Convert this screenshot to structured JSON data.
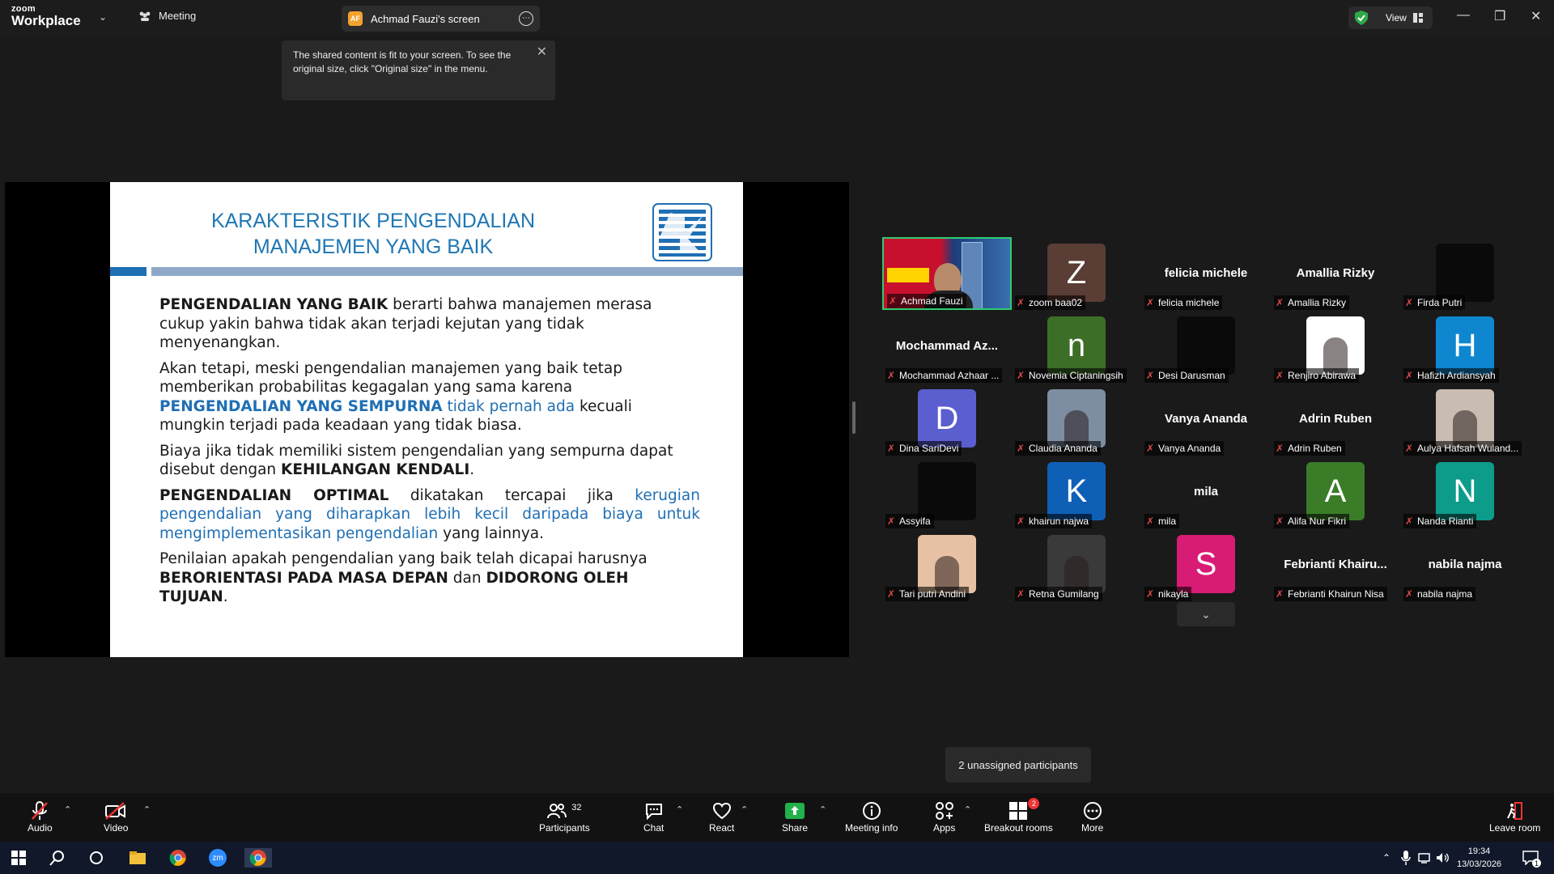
{
  "topbar": {
    "logo_small": "zoom",
    "logo_big": "Workplace",
    "meeting_label": "Meeting",
    "share_tab_initials": "AF",
    "share_tab_label": "Achmad Fauzi's screen",
    "view_label": "View"
  },
  "tooltip": {
    "text": "The shared content is fit to your screen. To see the original size, click \"Original size\" in the menu."
  },
  "slide": {
    "title": "KARAKTERISTIK PENGENDALIAN MANAJEMEN YANG BAIK",
    "p1_bold": "PENGENDALIAN YANG BAIK",
    "p1_rest": " berarti bahwa manajemen merasa cukup yakin bahwa tidak akan terjadi kejutan yang tidak menyenangkan.",
    "p2_a": "Akan tetapi, meski pengendalian manajemen yang baik tetap memberikan probabilitas kegagalan yang sama karena ",
    "p2_blue_bold": "PENGENDALIAN YANG SEMPURNA",
    "p2_blue": " tidak pernah ada",
    "p2_rest": " kecuali mungkin terjadi pada keadaan yang tidak biasa.",
    "p3_a": "Biaya jika tidak memiliki sistem pengendalian yang sempurna dapat disebut dengan ",
    "p3_bold": "KEHILANGAN KENDALI",
    "p3_end": ".",
    "p4_bold": "PENGENDALIAN OPTIMAL",
    "p4_a": " dikatakan tercapai jika ",
    "p4_blue": "kerugian pengendalian yang diharapkan lebih kecil daripada biaya untuk mengimplementasikan pengendalian",
    "p4_rest": " yang lainnya.",
    "p5_a": " Penilaian apakah pengendalian yang baik telah dicapai harusnya ",
    "p5_bold1": "BERORIENTASI PADA MASA DEPAN",
    "p5_mid": " dan ",
    "p5_bold2": "DIDORONG OLEH TUJUAN",
    "p5_end": "."
  },
  "participants": [
    {
      "label": "Achmad Fauzi",
      "kind": "video",
      "active": true
    },
    {
      "label": "zoom baa02",
      "kind": "letter",
      "letter": "Z",
      "color": "#5a3d35"
    },
    {
      "label": "felicia michele",
      "kind": "name",
      "big": "felicia michele"
    },
    {
      "label": "Amallia Rizky",
      "kind": "name",
      "big": "Amallia Rizky"
    },
    {
      "label": "Firda Putri",
      "kind": "dark"
    },
    {
      "label": "Mochammad Azhaar ...",
      "kind": "name",
      "big": "Mochammad  Az..."
    },
    {
      "label": "Novemia Ciptaningsih",
      "kind": "letter",
      "letter": "n",
      "color": "#3c6e27"
    },
    {
      "label": "Desi Darusman",
      "kind": "dark"
    },
    {
      "label": "Renjiro Abirawa",
      "kind": "photo",
      "color": "#ffffff"
    },
    {
      "label": "Hafizh Ardiansyah",
      "kind": "letter",
      "letter": "H",
      "color": "#0e87d0"
    },
    {
      "label": "Dina SariDevi",
      "kind": "letter",
      "letter": "D",
      "color": "#5a5ecf"
    },
    {
      "label": "Claudia Ananda",
      "kind": "photo",
      "color": "#7d8da2"
    },
    {
      "label": "Vanya Ananda",
      "kind": "name",
      "big": "Vanya Ananda"
    },
    {
      "label": "Adrin Ruben",
      "kind": "name",
      "big": "Adrin Ruben"
    },
    {
      "label": "Aulya Hafsah Wuland...",
      "kind": "photo",
      "color": "#c9bcb2"
    },
    {
      "label": "Assyifa",
      "kind": "dark"
    },
    {
      "label": "khairun najwa",
      "kind": "letter",
      "letter": "K",
      "color": "#0e5fb6"
    },
    {
      "label": "mila",
      "kind": "name",
      "big": "mila"
    },
    {
      "label": "Alifa Nur Fikri",
      "kind": "letter",
      "letter": "A",
      "color": "#3b7c28"
    },
    {
      "label": "Nanda Rianti",
      "kind": "letter",
      "letter": "N",
      "color": "#0d9b8a"
    },
    {
      "label": "Tari putri Andini",
      "kind": "photo",
      "color": "#e7c1a3"
    },
    {
      "label": "Retna Gumilang",
      "kind": "photo",
      "color": "#3a3a3a"
    },
    {
      "label": "nikayla",
      "kind": "letter",
      "letter": "S",
      "color": "#d81b74"
    },
    {
      "label": "Febrianti Khairun Nisa",
      "kind": "name",
      "big": "Febrianti  Khairu..."
    },
    {
      "label": "nabila najma",
      "kind": "name",
      "big": "nabila najma"
    }
  ],
  "unassigned": "2 unassigned participants",
  "toolbar": {
    "audio": "Audio",
    "video": "Video",
    "participants": "Participants",
    "participants_count": "32",
    "chat": "Chat",
    "react": "React",
    "share": "Share",
    "meeting_info": "Meeting info",
    "apps": "Apps",
    "breakout": "Breakout rooms",
    "breakout_badge": "2",
    "more": "More",
    "leave": "Leave room"
  },
  "taskbar": {
    "time": "19:34",
    "date": "13/03/2026",
    "zoom_label": "zm",
    "notif_count": "1"
  },
  "colors": {
    "accent_green": "#2ecc71",
    "slide_blue": "#1f6fb4",
    "mute_red": "#e04848"
  }
}
